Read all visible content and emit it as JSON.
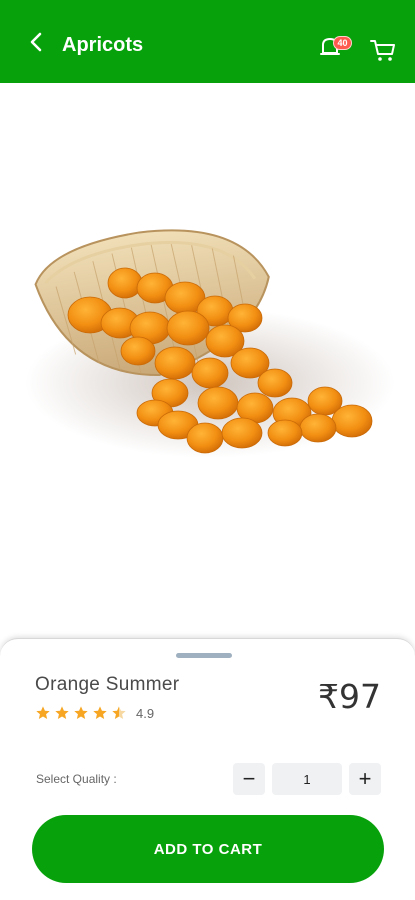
{
  "header": {
    "title": "Apricots",
    "notification_count": "40",
    "background": "#07a10b",
    "icons": {
      "back": "back-arrow-icon",
      "notifications": "bell-icon",
      "cart": "cart-icon"
    }
  },
  "product": {
    "image": "dried-apricots-in-basket",
    "name": "Orange Summer",
    "rating": "4.9",
    "rating_stars": 4.5,
    "price": "₹97"
  },
  "quantity": {
    "label": "Select Quality :",
    "value": "1",
    "minus_symbol": "−",
    "plus_symbol": "+"
  },
  "actions": {
    "add_to_cart": "ADD TO CART",
    "accent": "#07a10b"
  },
  "colors": {
    "star": "#f6a623",
    "badge": "#ff5a4e"
  }
}
